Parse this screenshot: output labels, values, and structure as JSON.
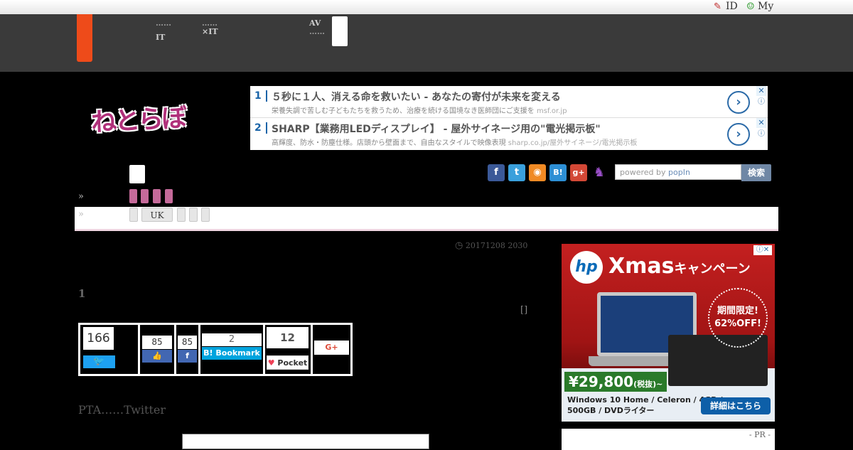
{
  "util": {
    "id_label": "ID",
    "my_label": "My"
  },
  "nav": {
    "item1_line1": "……",
    "item1_line2": "IT",
    "item2_line1": "……",
    "item2_line2": "×IT",
    "item3_line1": "AV",
    "item3_line2": "……"
  },
  "logo": {
    "text": "ねとらぼ"
  },
  "ads": [
    {
      "num": "1",
      "title": "５秒に１人、消える命を救いたい - あなたの寄付が未来を変える",
      "desc": "栄養失調で苦しむ子どもたちを救うため、治療を続ける国境なき医師団にご支援を",
      "domain": "msf.or.jp"
    },
    {
      "num": "2",
      "title": "SHARP【業務用LEDディスプレイ】 - 屋外サイネージ用の\"電光掲示板\"",
      "desc": "高輝度、防水・防塵仕様。店頭から壁面まで、自由なスタイルで映像表現",
      "domain": "sharp.co.jp/屋外サイネージ/電光掲示板"
    }
  ],
  "social": [
    "facebook-icon",
    "twitter-icon",
    "rss-icon",
    "hatena-icon",
    "googleplus-icon",
    "cat-icon"
  ],
  "search": {
    "powered": "powered by",
    "brand": "popIn",
    "button": "検索"
  },
  "tags": {
    "raquo": "»",
    "uk": "UK"
  },
  "article": {
    "date": "20171208 2030",
    "number": "1",
    "bracket": "[]",
    "lede": "PTA……Twitter"
  },
  "share": {
    "twitter_count": "166",
    "fb_like_count": "85",
    "fb_share_count": "85",
    "hatena_count": "2",
    "hatena_label": "Bookmark",
    "pocket_count": "12",
    "pocket_label": "Pocket",
    "gplus_label": "G+"
  },
  "hp_ad": {
    "logo": "hp",
    "headline": "Xmas",
    "headline_sub": "キャンペーン",
    "limited_line1": "期間限定!",
    "limited_line2": "62%OFF!",
    "price": "¥29,800",
    "price_note": "(税抜)~",
    "spec_line1": "Windows 10 Home / Celeron / 4GB /",
    "spec_line2": "500GB / DVDライター",
    "detail_button": "詳細はこちら",
    "info": "ⓘ✕"
  },
  "pr_label": "- PR -",
  "colors": {
    "nav_bg": "#3a3a3a",
    "accent_orange": "#ee4b1a",
    "tag_pink": "#c56a9a",
    "ad_blue": "#1a64a8"
  }
}
